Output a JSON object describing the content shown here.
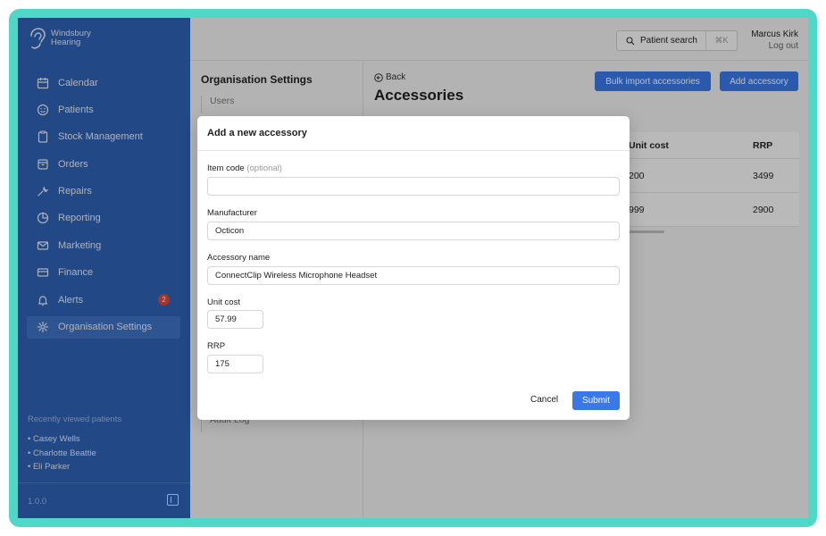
{
  "brand": {
    "line1": "Windsbury",
    "line2": "Hearing"
  },
  "sidebar": {
    "items": [
      {
        "label": "Calendar",
        "icon": "calendar-icon"
      },
      {
        "label": "Patients",
        "icon": "smiley-icon"
      },
      {
        "label": "Stock Management",
        "icon": "clipboard-icon"
      },
      {
        "label": "Orders",
        "icon": "box-icon"
      },
      {
        "label": "Repairs",
        "icon": "wrench-icon"
      },
      {
        "label": "Reporting",
        "icon": "pie-chart-icon"
      },
      {
        "label": "Marketing",
        "icon": "envelope-icon"
      },
      {
        "label": "Finance",
        "icon": "credit-card-icon"
      },
      {
        "label": "Alerts",
        "icon": "bell-icon",
        "badge": "2"
      },
      {
        "label": "Organisation Settings",
        "icon": "gear-icon",
        "active": true
      }
    ],
    "recent_title": "Recently viewed patients",
    "recent": [
      "• Casey Wells",
      "• Charlotte Beattie",
      "• Eli Parker"
    ],
    "version": "1.0.0"
  },
  "header": {
    "search_label": "Patient search",
    "search_shortcut": "⌘K",
    "user_name": "Marcus Kirk",
    "logout": "Log out"
  },
  "settings": {
    "title": "Organisation Settings",
    "links_top": [
      "Users"
    ],
    "links_bottom": [
      "Audit Log"
    ]
  },
  "main": {
    "back": "Back",
    "title": "Accessories",
    "bulk_button": "Bulk import accessories",
    "add_button": "Add accessory",
    "columns": [
      "Unit cost",
      "RRP"
    ],
    "rows": [
      {
        "unit_cost": "200",
        "rrp": "3499"
      },
      {
        "unit_cost": "999",
        "rrp": "2900"
      }
    ]
  },
  "modal": {
    "title": "Add a new accessory",
    "item_code_label": "Item code",
    "item_code_optional": "(optional)",
    "item_code_value": "",
    "manufacturer_label": "Manufacturer",
    "manufacturer_value": "Octicon",
    "accessory_name_label": "Accessory name",
    "accessory_name_value": "ConnectClip Wireless Microphone Headset",
    "unit_cost_label": "Unit cost",
    "unit_cost_value": "57.99",
    "rrp_label": "RRP",
    "rrp_value": "175",
    "cancel": "Cancel",
    "submit": "Submit"
  },
  "colors": {
    "sidebar": "#2f62b5",
    "accent": "#3b78e7",
    "frame": "#4fd7c8",
    "badge": "#e2453c"
  }
}
